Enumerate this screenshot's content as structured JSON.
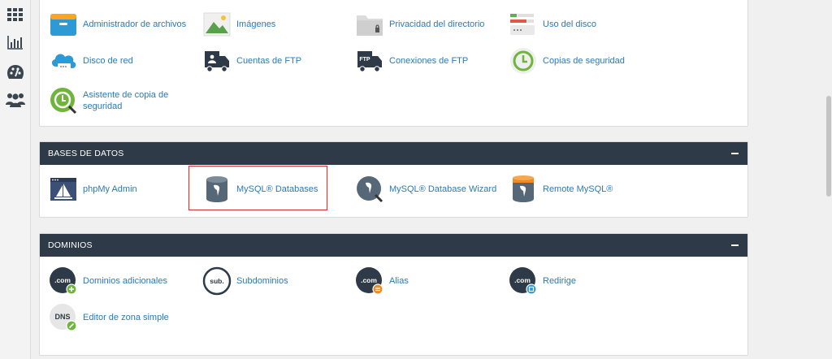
{
  "sidebar": {
    "items": [
      {
        "icon": "grid-icon"
      },
      {
        "icon": "bar-chart-icon"
      },
      {
        "icon": "palette-icon"
      },
      {
        "icon": "users-icon"
      }
    ]
  },
  "files": {
    "items": [
      {
        "label": "Administrador de archivos",
        "icon": "file-manager-icon"
      },
      {
        "label": "Imágenes",
        "icon": "images-icon"
      },
      {
        "label": "Privacidad del directorio",
        "icon": "directory-privacy-icon"
      },
      {
        "label": "Uso del disco",
        "icon": "disk-usage-icon"
      },
      {
        "label": "Disco de red",
        "icon": "network-disk-icon"
      },
      {
        "label": "Cuentas de FTP",
        "icon": "ftp-accounts-icon"
      },
      {
        "label": "Conexiones de FTP",
        "icon": "ftp-connections-icon"
      },
      {
        "label": "Copias de seguridad",
        "icon": "backup-icon"
      },
      {
        "label": "Asistente de copia de seguridad",
        "icon": "backup-wizard-icon"
      }
    ]
  },
  "databases": {
    "title": "BASES DE DATOS",
    "items": [
      {
        "label": "phpMy Admin",
        "icon": "phpmyadmin-icon"
      },
      {
        "label": "MySQL® Databases",
        "icon": "mysql-databases-icon"
      },
      {
        "label": "MySQL® Database Wizard",
        "icon": "mysql-wizard-icon"
      },
      {
        "label": "Remote MySQL®",
        "icon": "remote-mysql-icon"
      }
    ]
  },
  "domains": {
    "title": "DOMINIOS",
    "items": [
      {
        "label": "Dominios adicionales",
        "icon": "addon-domains-icon",
        "badge_text": ".com"
      },
      {
        "label": "Subdominios",
        "icon": "subdomains-icon",
        "badge_text": "sub."
      },
      {
        "label": "Alias",
        "icon": "aliases-icon",
        "badge_text": ".com"
      },
      {
        "label": "Redirige",
        "icon": "redirects-icon",
        "badge_text": ".com"
      },
      {
        "label": "Editor de zona simple",
        "icon": "zone-editor-icon",
        "badge_text": "DNS"
      }
    ]
  },
  "colors": {
    "header_bg": "#2e3a47",
    "link": "#2a7ab8",
    "highlight": "#d32f2f"
  }
}
